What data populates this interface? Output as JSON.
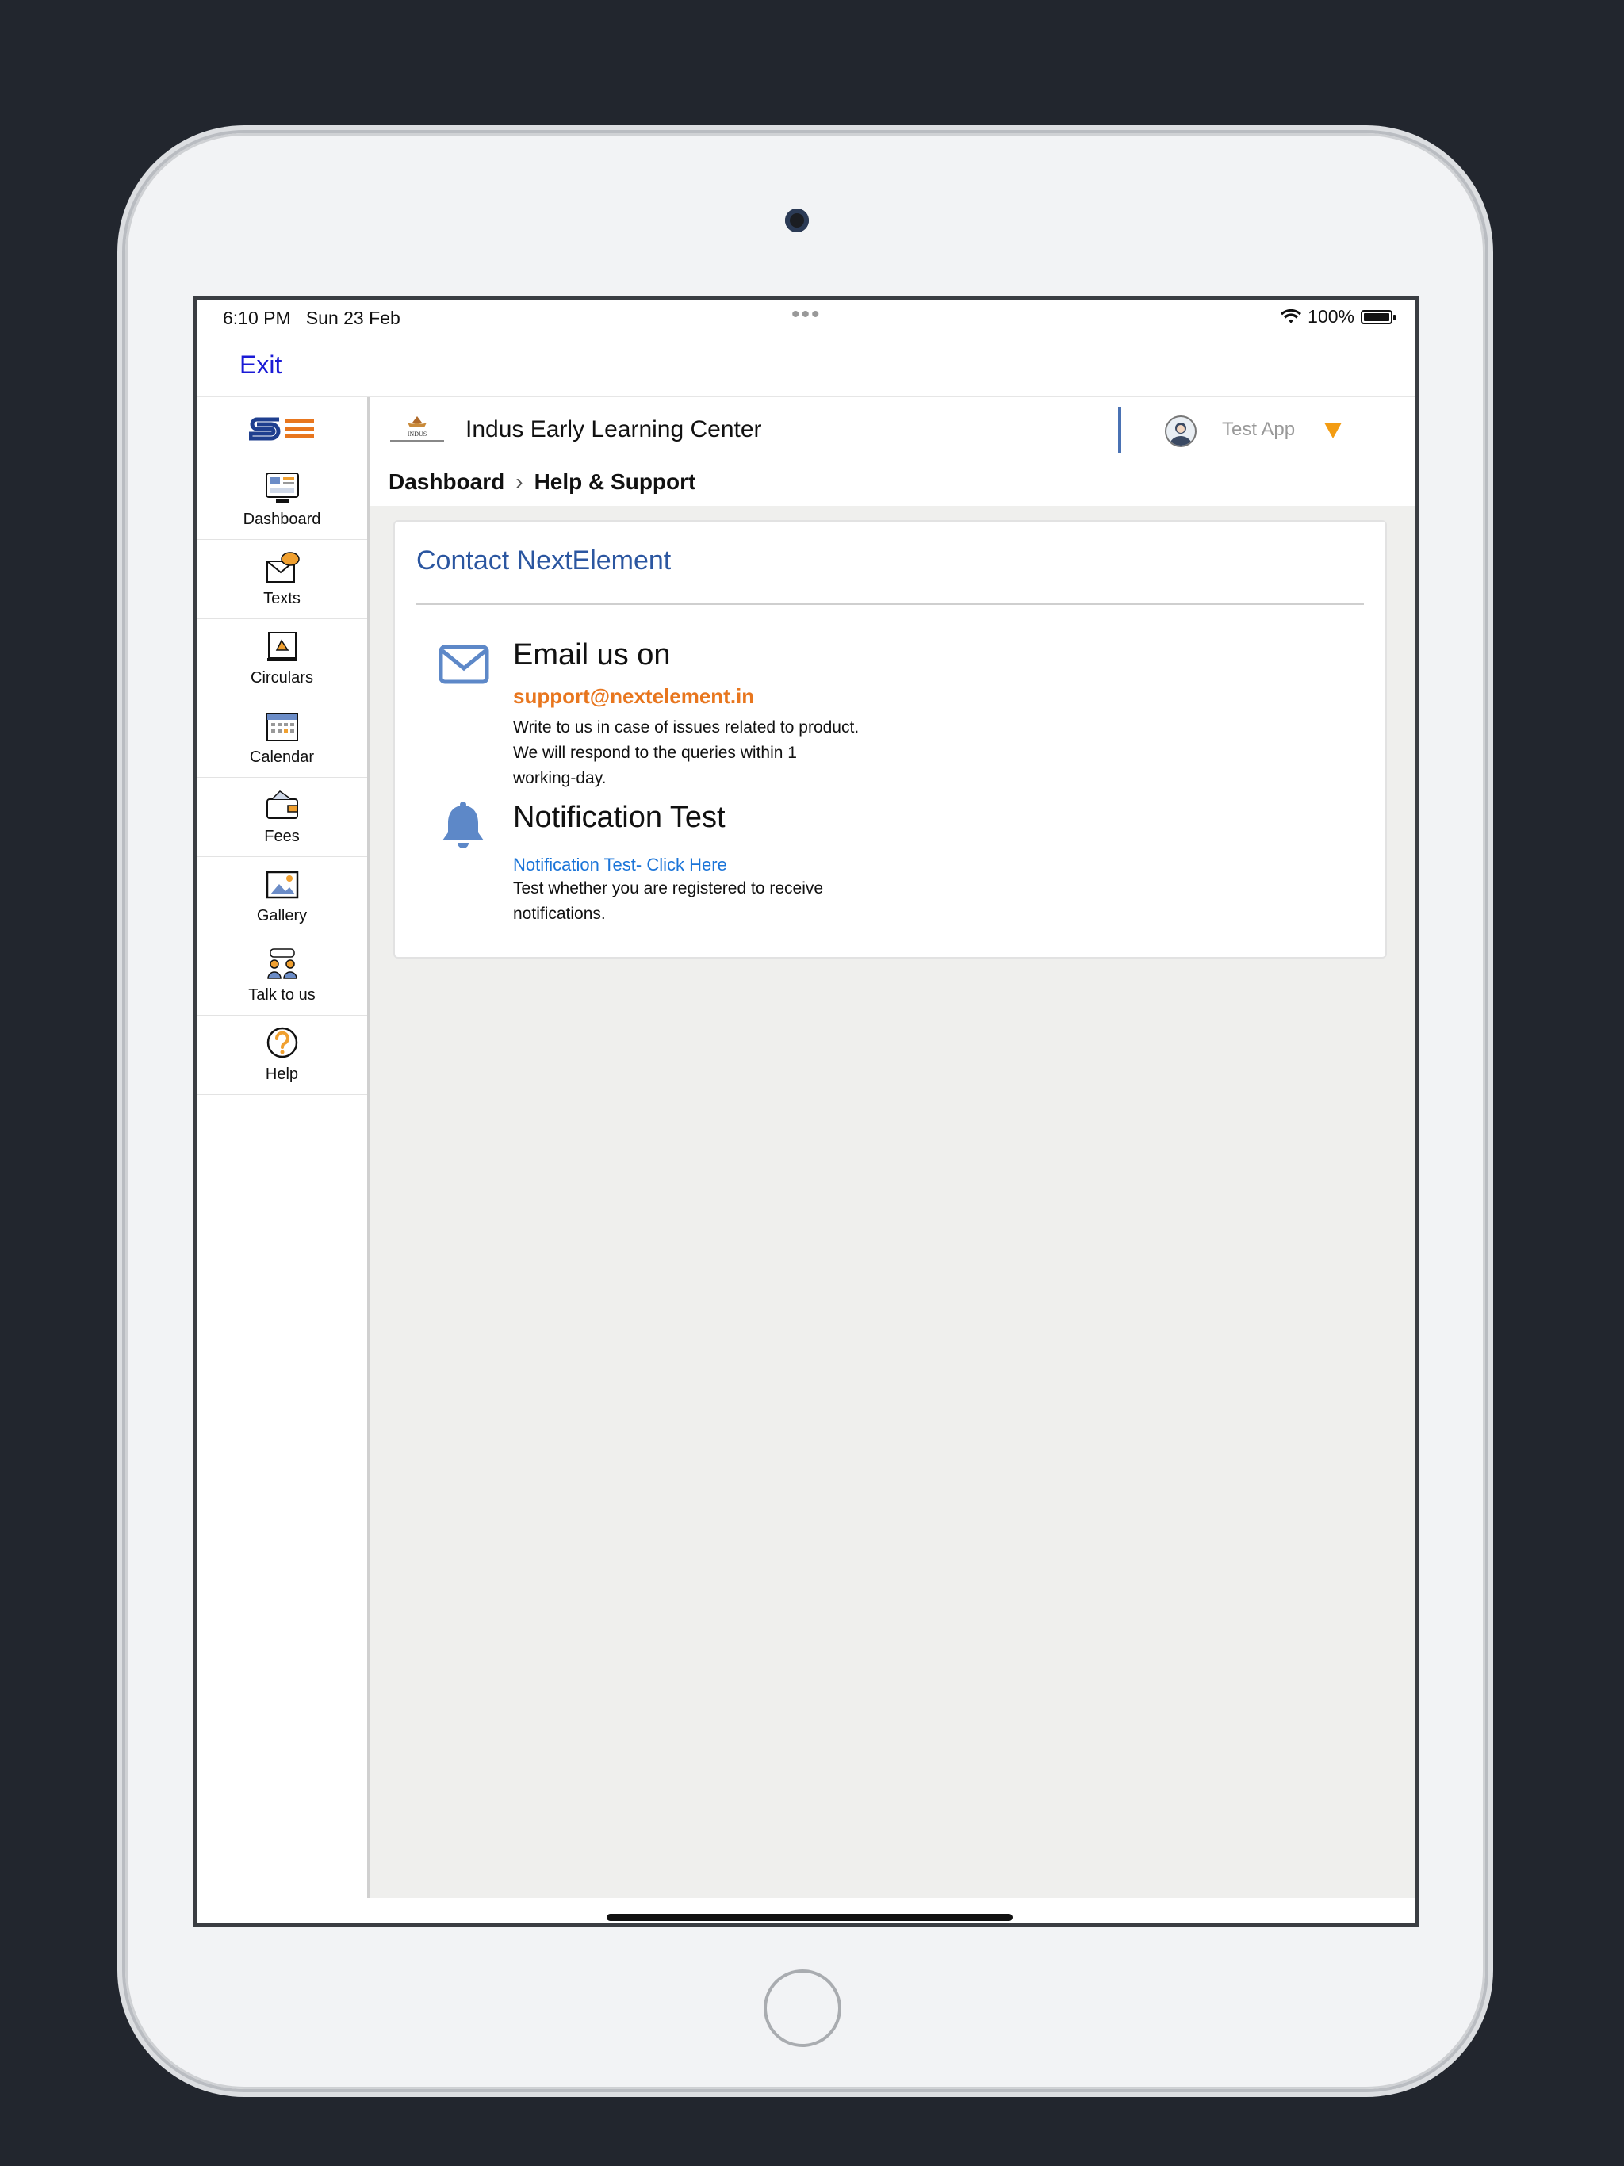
{
  "status_bar": {
    "time": "6:10 PM",
    "date": "Sun 23 Feb",
    "dots": "•••",
    "battery": "100%"
  },
  "exit_label": "Exit",
  "sidebar": {
    "items": [
      {
        "label": "Dashboard",
        "icon": "dashboard-icon"
      },
      {
        "label": "Texts",
        "icon": "texts-icon"
      },
      {
        "label": "Circulars",
        "icon": "circulars-icon"
      },
      {
        "label": "Calendar",
        "icon": "calendar-icon"
      },
      {
        "label": "Fees",
        "icon": "fees-icon"
      },
      {
        "label": "Gallery",
        "icon": "gallery-icon"
      },
      {
        "label": "Talk to us",
        "icon": "talk-to-us-icon"
      },
      {
        "label": "Help",
        "icon": "help-icon"
      }
    ]
  },
  "header": {
    "school_name": "Indus Early Learning Center",
    "user_name": "Test App"
  },
  "breadcrumb": {
    "root": "Dashboard",
    "separator": "›",
    "current": "Help & Support"
  },
  "card": {
    "title": "Contact NextElement",
    "email": {
      "title": "Email us on",
      "address": "support@nextelement.in",
      "description": "Write to us in case of issues related to product. We will respond to the queries within 1 working-day."
    },
    "notification": {
      "title": "Notification Test",
      "link": "Notification Test- Click Here",
      "description": "Test whether you are registered to receive notifications."
    }
  },
  "colors": {
    "accent_blue": "#2b56a0",
    "link_blue": "#1a74d8",
    "orange": "#e8761e",
    "caret": "#f39c12"
  }
}
